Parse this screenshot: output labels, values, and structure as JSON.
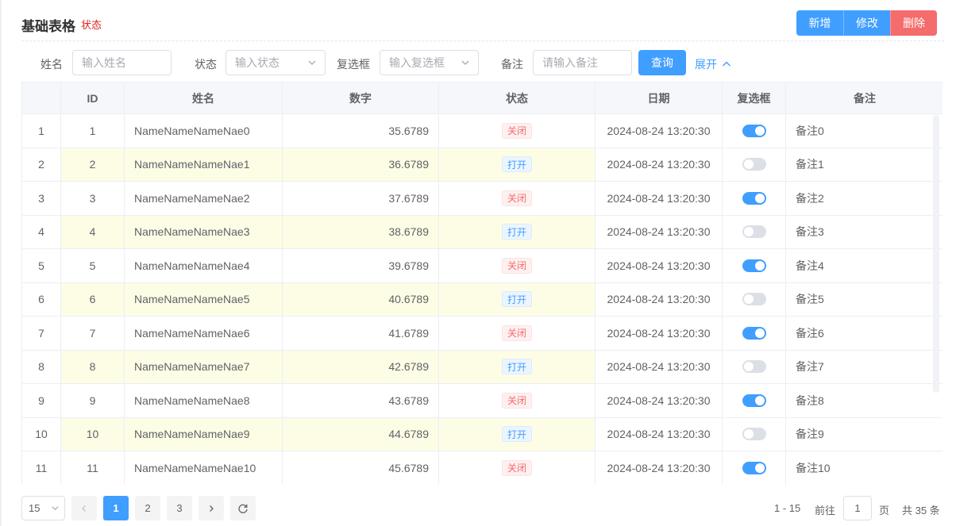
{
  "header": {
    "title": "基础表格",
    "subtitle": "状态",
    "buttons": {
      "add": "新增",
      "edit": "修改",
      "delete": "删除"
    }
  },
  "filter": {
    "name_label": "姓名",
    "name_placeholder": "输入姓名",
    "status_label": "状态",
    "status_placeholder": "输入状态",
    "checkbox_label": "复选框",
    "checkbox_placeholder": "输入复选框",
    "note_label": "备注",
    "note_placeholder": "请输入备注",
    "query_button": "查询",
    "expand_label": "展开"
  },
  "table": {
    "columns": [
      "",
      "ID",
      "姓名",
      "数字",
      "状态",
      "日期",
      "复选框",
      "备注"
    ],
    "rows": [
      {
        "idx": "1",
        "id": "1",
        "name": "NameNameNameNae0",
        "num": "35.6789",
        "status": "关闭",
        "state": "off",
        "date": "2024-08-24 13:20:30",
        "checked": true,
        "note": "备注0"
      },
      {
        "idx": "2",
        "id": "2",
        "name": "NameNameNameNae1",
        "num": "36.6789",
        "status": "打开",
        "state": "on",
        "date": "2024-08-24 13:20:30",
        "checked": false,
        "note": "备注1"
      },
      {
        "idx": "3",
        "id": "3",
        "name": "NameNameNameNae2",
        "num": "37.6789",
        "status": "关闭",
        "state": "off",
        "date": "2024-08-24 13:20:30",
        "checked": true,
        "note": "备注2"
      },
      {
        "idx": "4",
        "id": "4",
        "name": "NameNameNameNae3",
        "num": "38.6789",
        "status": "打开",
        "state": "on",
        "date": "2024-08-24 13:20:30",
        "checked": false,
        "note": "备注3"
      },
      {
        "idx": "5",
        "id": "5",
        "name": "NameNameNameNae4",
        "num": "39.6789",
        "status": "关闭",
        "state": "off",
        "date": "2024-08-24 13:20:30",
        "checked": true,
        "note": "备注4"
      },
      {
        "idx": "6",
        "id": "6",
        "name": "NameNameNameNae5",
        "num": "40.6789",
        "status": "打开",
        "state": "on",
        "date": "2024-08-24 13:20:30",
        "checked": false,
        "note": "备注5"
      },
      {
        "idx": "7",
        "id": "7",
        "name": "NameNameNameNae6",
        "num": "41.6789",
        "status": "关闭",
        "state": "off",
        "date": "2024-08-24 13:20:30",
        "checked": true,
        "note": "备注6"
      },
      {
        "idx": "8",
        "id": "8",
        "name": "NameNameNameNae7",
        "num": "42.6789",
        "status": "打开",
        "state": "on",
        "date": "2024-08-24 13:20:30",
        "checked": false,
        "note": "备注7"
      },
      {
        "idx": "9",
        "id": "9",
        "name": "NameNameNameNae8",
        "num": "43.6789",
        "status": "关闭",
        "state": "off",
        "date": "2024-08-24 13:20:30",
        "checked": true,
        "note": "备注8"
      },
      {
        "idx": "10",
        "id": "10",
        "name": "NameNameNameNae9",
        "num": "44.6789",
        "status": "打开",
        "state": "on",
        "date": "2024-08-24 13:20:30",
        "checked": false,
        "note": "备注9"
      },
      {
        "idx": "11",
        "id": "11",
        "name": "NameNameNameNae10",
        "num": "45.6789",
        "status": "关闭",
        "state": "off",
        "date": "2024-08-24 13:20:30",
        "checked": true,
        "note": "备注10"
      }
    ]
  },
  "pagination": {
    "page_size": "15",
    "pages": [
      "1",
      "2",
      "3"
    ],
    "current_page": "1",
    "range": "1 - 15",
    "goto_label": "前往",
    "goto_value": "1",
    "page_unit": "页",
    "total": "共 35 条"
  },
  "colors": {
    "primary": "#409eff",
    "danger": "#f56c6c",
    "highlight_row": "#fdfde6"
  }
}
